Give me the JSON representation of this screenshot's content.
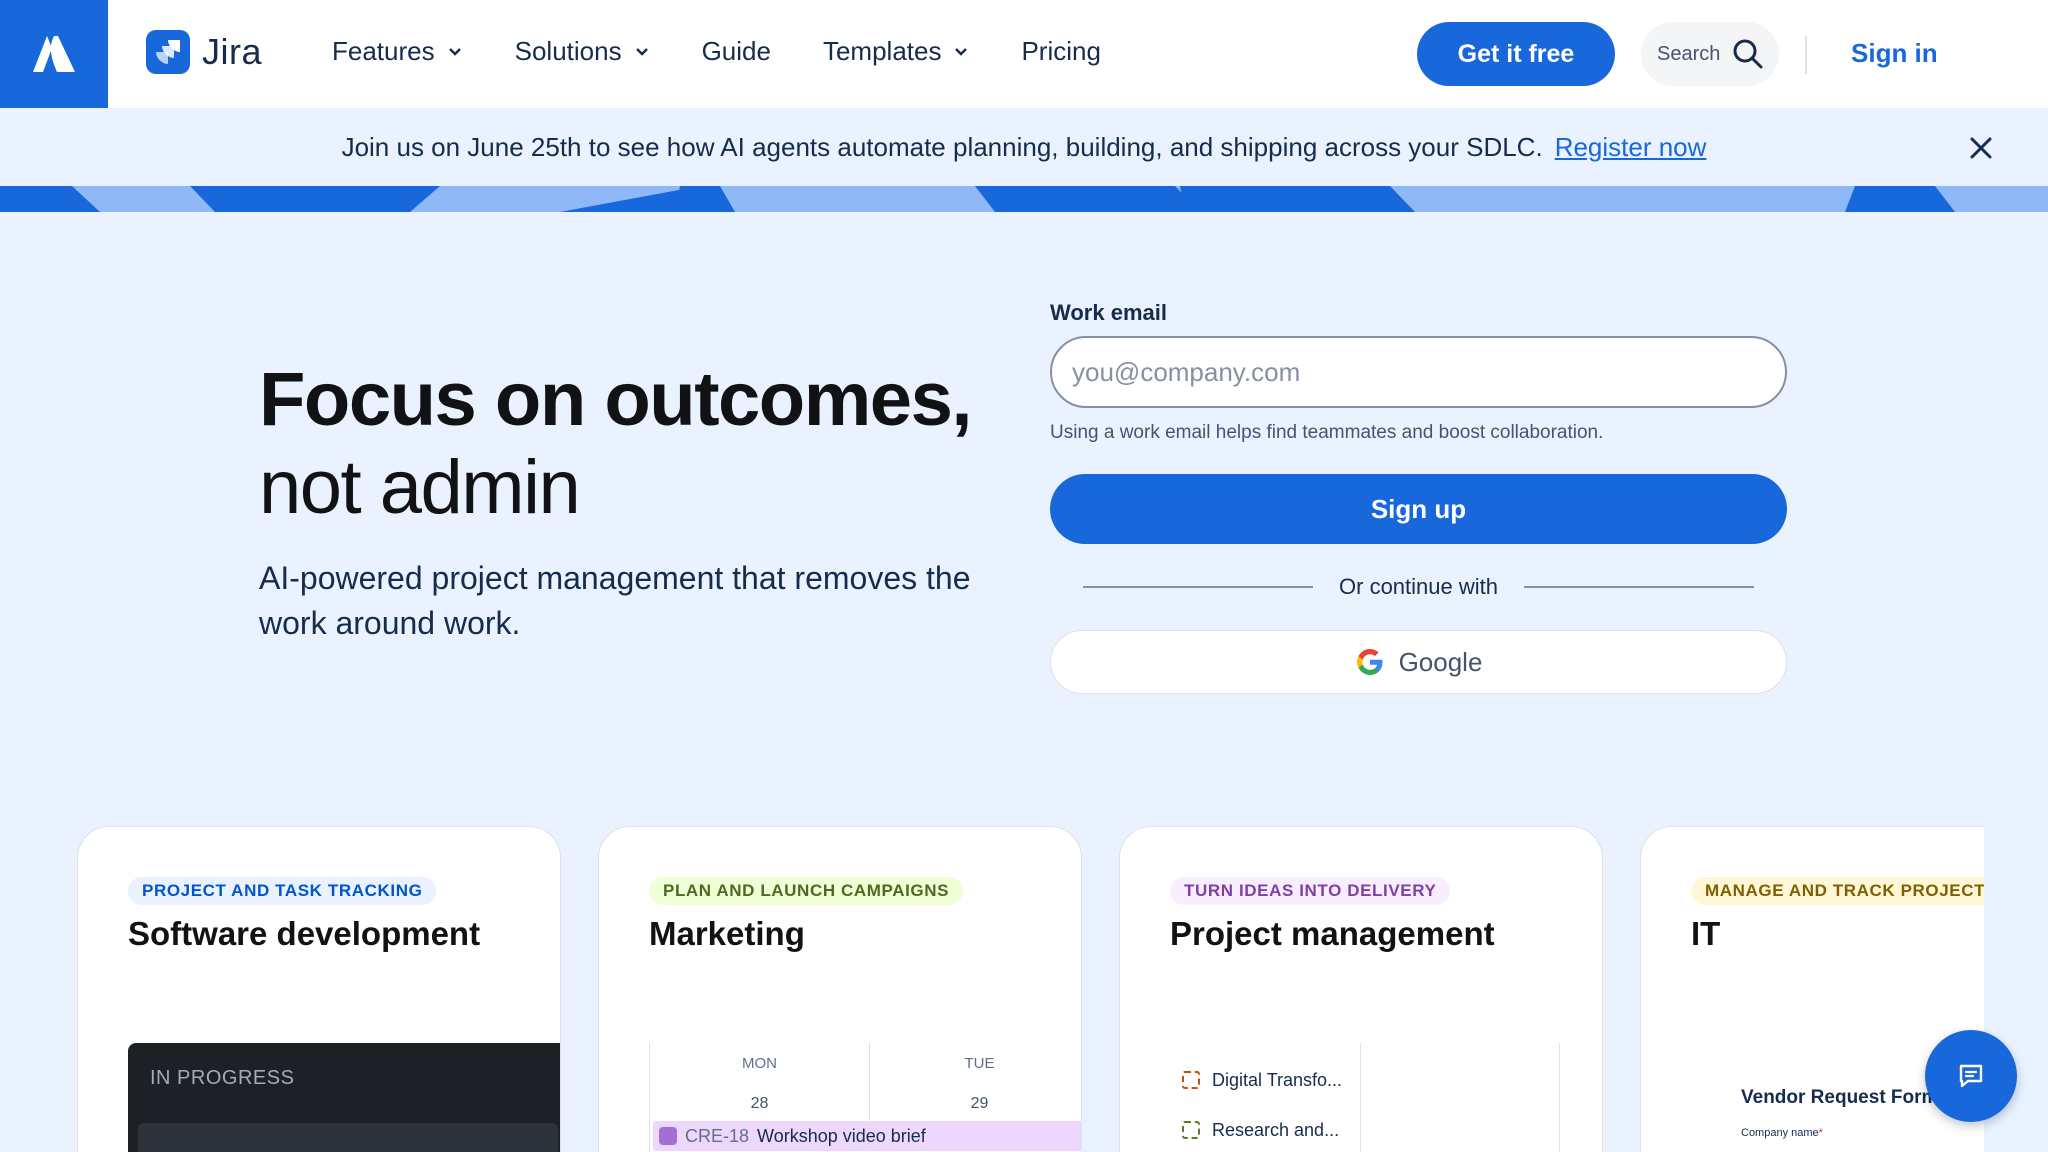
{
  "brand": {
    "product": "Jira"
  },
  "nav": {
    "items": [
      {
        "label": "Features",
        "has_dropdown": true
      },
      {
        "label": "Solutions",
        "has_dropdown": true
      },
      {
        "label": "Guide",
        "has_dropdown": false
      },
      {
        "label": "Templates",
        "has_dropdown": true
      },
      {
        "label": "Pricing",
        "has_dropdown": false
      }
    ],
    "cta_label": "Get it free",
    "search_label": "Search",
    "signin_label": "Sign in"
  },
  "banner": {
    "text": "Join us on June 25th to see how AI agents automate planning, building, and shipping across your SDLC.",
    "link_label": "Register now"
  },
  "hero": {
    "title_bold": "Focus on outcomes,",
    "title_light": "not admin",
    "subtitle": "AI-powered project management that removes the work around work."
  },
  "signup": {
    "email_label": "Work email",
    "email_placeholder": "you@company.com",
    "email_value": "",
    "hint": "Using a work email helps find teammates and boost collaboration.",
    "submit_label": "Sign up",
    "divider_text": "Or continue with",
    "google_label": "Google"
  },
  "cards": [
    {
      "tag": "PROJECT AND TASK TRACKING",
      "title": "Software development",
      "preview": {
        "status": "IN PROGRESS"
      }
    },
    {
      "tag": "PLAN AND LAUNCH CAMPAIGNS",
      "title": "Marketing",
      "preview": {
        "days": [
          {
            "name": "MON",
            "date": "28"
          },
          {
            "name": "TUE",
            "date": "29"
          }
        ],
        "event_key": "CRE-18",
        "event_title": "Workshop video brief"
      }
    },
    {
      "tag": "TURN IDEAS INTO DELIVERY",
      "title": "Project management",
      "preview": {
        "items": [
          "Digital Transfo...",
          "Research and..."
        ]
      }
    },
    {
      "tag": "MANAGE AND TRACK PROJECTS",
      "title": "IT",
      "preview": {
        "form_title": "Vendor Request Form",
        "field_label": "Company name"
      }
    }
  ],
  "colors": {
    "brand_blue": "#1868db",
    "banner_bg": "#e9f2fe",
    "tag_blue_bg": "#e9f2fe",
    "tag_blue_fg": "#0055cc",
    "tag_green_bg": "#efffd6",
    "tag_green_fg": "#4c6b1f",
    "tag_purple_bg": "#f8eefe",
    "tag_purple_fg": "#803fa5",
    "tag_yellow_bg": "#fff7d6",
    "tag_yellow_fg": "#7f5f01"
  },
  "icons": [
    "atlassian-logo-icon",
    "jira-logo-icon",
    "chevron-down-icon",
    "search-icon",
    "close-icon",
    "google-icon",
    "chat-icon"
  ]
}
